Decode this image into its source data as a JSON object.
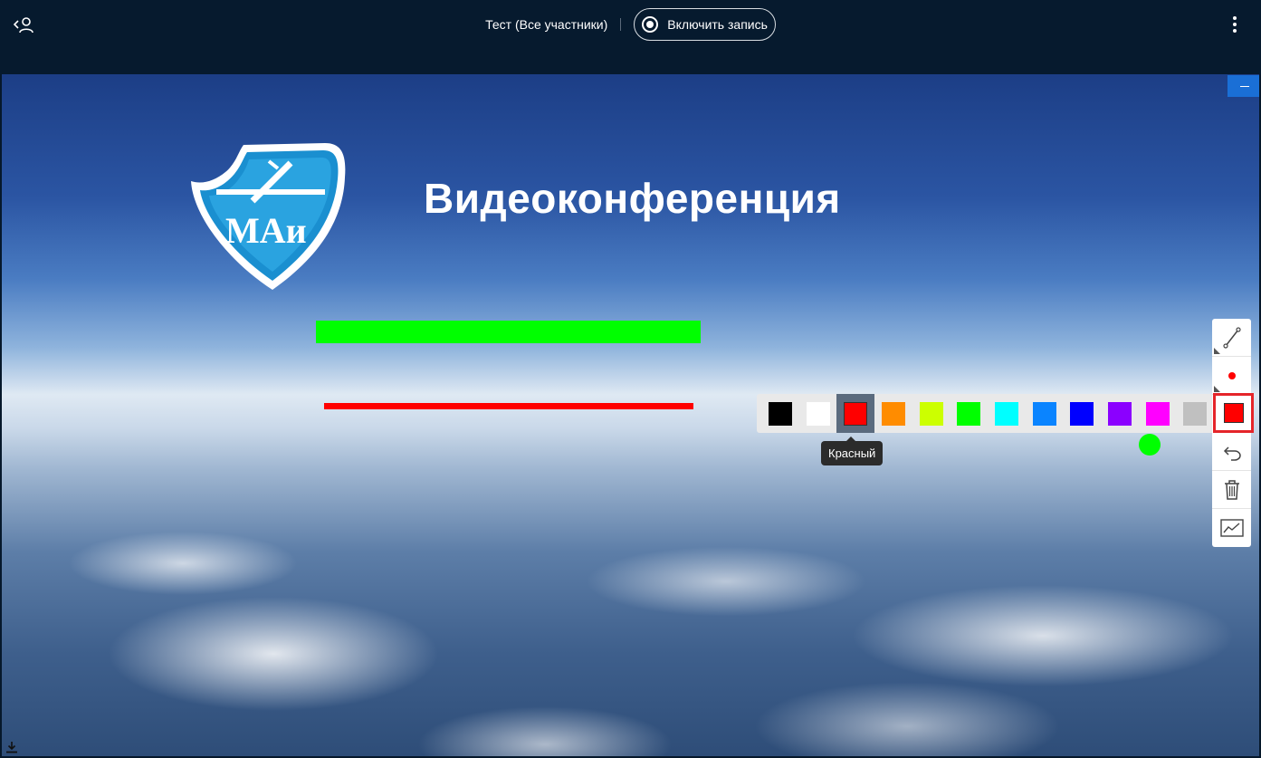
{
  "header": {
    "meeting_title": "Тест (Все участники)",
    "record_button_label": "Включить запись"
  },
  "slide": {
    "title": "Видеоконференция",
    "logo_text": "МАи"
  },
  "drawing_toolbar": {
    "tools": [
      "line-tool-icon",
      "brush-size-icon",
      "color-picker-icon",
      "undo-icon",
      "trash-icon",
      "chart-icon"
    ],
    "selected_color": "#ff0000"
  },
  "palette": {
    "colors": [
      {
        "name": "Черный",
        "hex": "#000000"
      },
      {
        "name": "Белый",
        "hex": "#ffffff"
      },
      {
        "name": "Красный",
        "hex": "#ff0000"
      },
      {
        "name": "Оранжевый",
        "hex": "#ff8c00"
      },
      {
        "name": "Лайм",
        "hex": "#ccff00"
      },
      {
        "name": "Зеленый",
        "hex": "#00ff00"
      },
      {
        "name": "Голубой",
        "hex": "#00ffff"
      },
      {
        "name": "Синий светлый",
        "hex": "#0a84ff"
      },
      {
        "name": "Синий",
        "hex": "#0000ff"
      },
      {
        "name": "Фиолетовый",
        "hex": "#8b00ff"
      },
      {
        "name": "Пурпурный",
        "hex": "#ff00ff"
      },
      {
        "name": "Серый",
        "hex": "#c0c0c0"
      }
    ],
    "active_index": 2,
    "tooltip": "Красный"
  },
  "annotations": {
    "green_line_color": "#00ff00",
    "red_line_color": "#ff0000",
    "pointer_color": "#00ff00"
  }
}
